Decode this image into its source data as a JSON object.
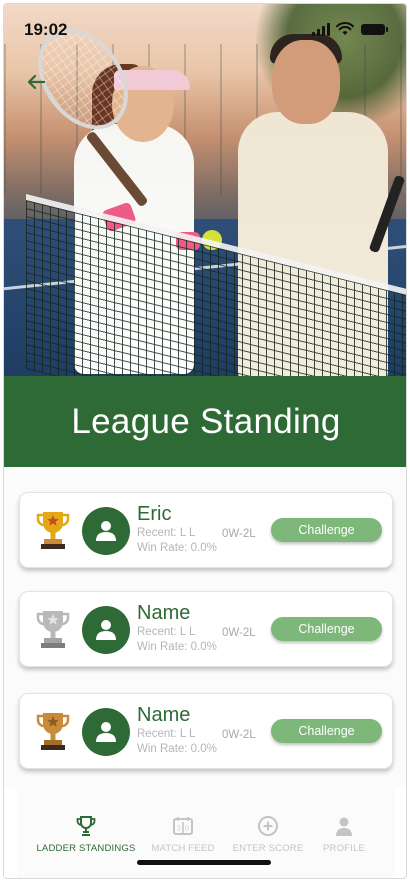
{
  "status_bar": {
    "time": "19:02"
  },
  "header": {
    "back_icon": "arrow-left-icon"
  },
  "banner": {
    "title": "League Standing"
  },
  "colors": {
    "brand_green": "#2e6a35",
    "button_green": "#7db77a",
    "gold": "#e2a816",
    "silver": "#b9b9b9",
    "bronze": "#c98a3a"
  },
  "standings": [
    {
      "rank_icon": "gold-trophy-icon",
      "name": "Eric",
      "recent": "Recent: L L",
      "win_rate": "Win Rate: 0.0%",
      "record": "0W-2L",
      "button": "Challenge"
    },
    {
      "rank_icon": "silver-trophy-icon",
      "name": "Name",
      "recent": "Recent: L L",
      "win_rate": "Win Rate: 0.0%",
      "record": "0W-2L",
      "button": "Challenge"
    },
    {
      "rank_icon": "bronze-trophy-icon",
      "name": "Name",
      "recent": "Recent: L L",
      "win_rate": "Win Rate: 0.0%",
      "record": "0W-2L",
      "button": "Challenge"
    }
  ],
  "nav": {
    "items": [
      {
        "label": "LADDER STANDINGS",
        "icon": "trophy-icon",
        "active": true
      },
      {
        "label": "MATCH FEED",
        "icon": "scoreboard-icon",
        "active": false
      },
      {
        "label": "ENTER SCORE",
        "icon": "plus-circle-icon",
        "active": false
      },
      {
        "label": "PROFILE",
        "icon": "person-icon",
        "active": false
      }
    ]
  }
}
